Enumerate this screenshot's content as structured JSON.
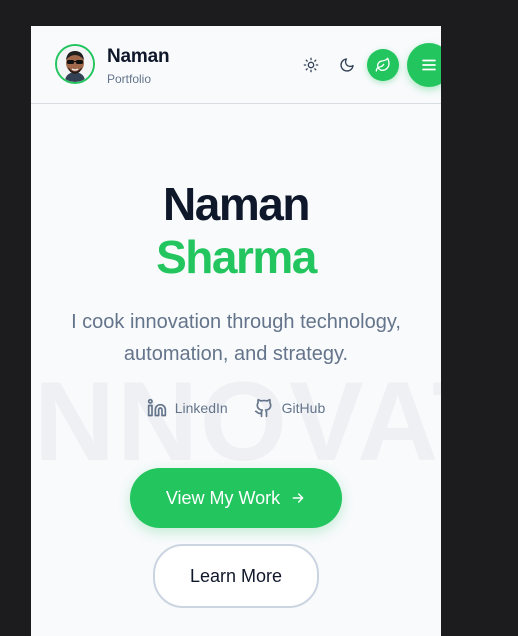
{
  "header": {
    "brand_name": "Naman",
    "brand_sub": "Portfolio"
  },
  "hero": {
    "first_name": "Naman",
    "last_name": "Sharma",
    "tagline": "I cook innovation through technology, automation, and strategy.",
    "watermark": "INNOVATION"
  },
  "socials": [
    {
      "label": "LinkedIn",
      "icon": "linkedin-icon"
    },
    {
      "label": "GitHub",
      "icon": "github-icon"
    }
  ],
  "actions": {
    "primary_label": "View My Work",
    "secondary_label": "Learn More"
  },
  "colors": {
    "accent": "#22c55e",
    "heading": "#0f172a",
    "muted": "#64748b",
    "background": "#f8fafc"
  }
}
